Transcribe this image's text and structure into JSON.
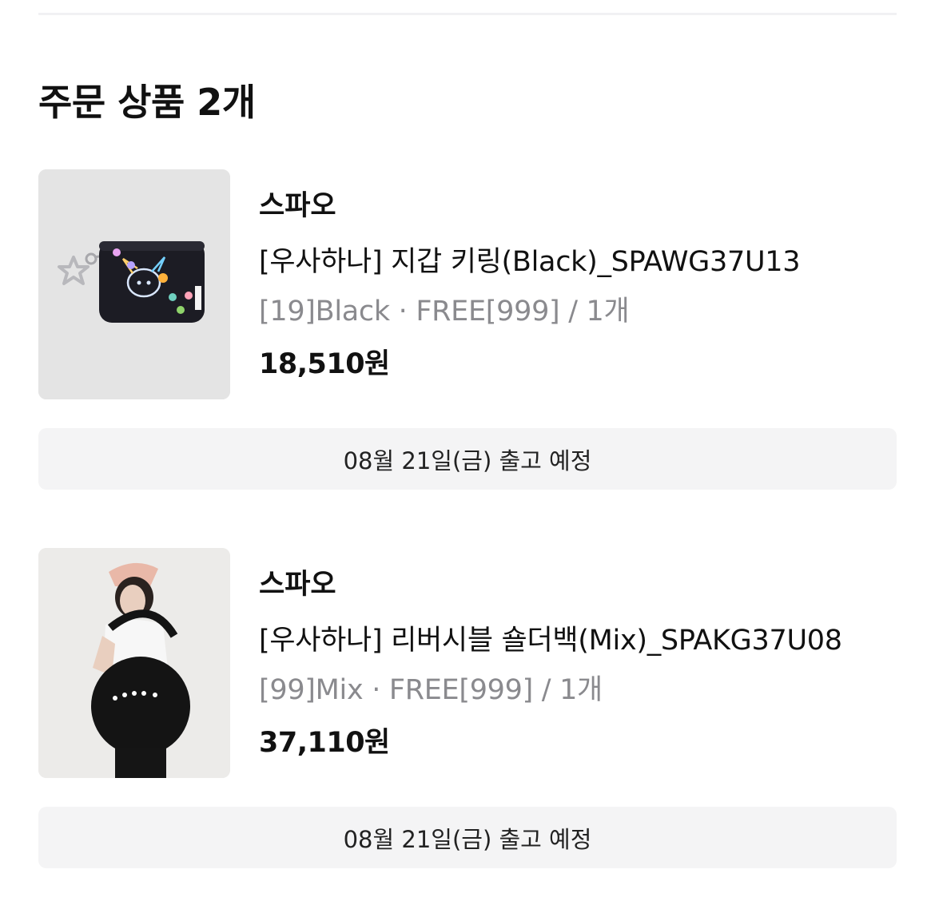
{
  "section": {
    "title": "주문 상품 2개"
  },
  "items": [
    {
      "brand": "스파오",
      "name": "[우사하나] 지갑 키링(Black)_SPAWG37U13",
      "options": "[19]Black · FREE[999] / 1개",
      "price": "18,510원",
      "shipping": "08월 21일(금) 출고 예정",
      "image_icon": "product-image-wallet-keyring"
    },
    {
      "brand": "스파오",
      "name": "[우사하나] 리버시블 숄더백(Mix)_SPAKG37U08",
      "options": "[99]Mix · FREE[999] / 1개",
      "price": "37,110원",
      "shipping": "08월 21일(금) 출고 예정",
      "image_icon": "product-image-shoulder-bag"
    }
  ],
  "colors": {
    "text_primary": "#111111",
    "text_secondary": "#8a8a8e",
    "box_background": "#f4f4f5",
    "divider": "#f1f1f3"
  }
}
